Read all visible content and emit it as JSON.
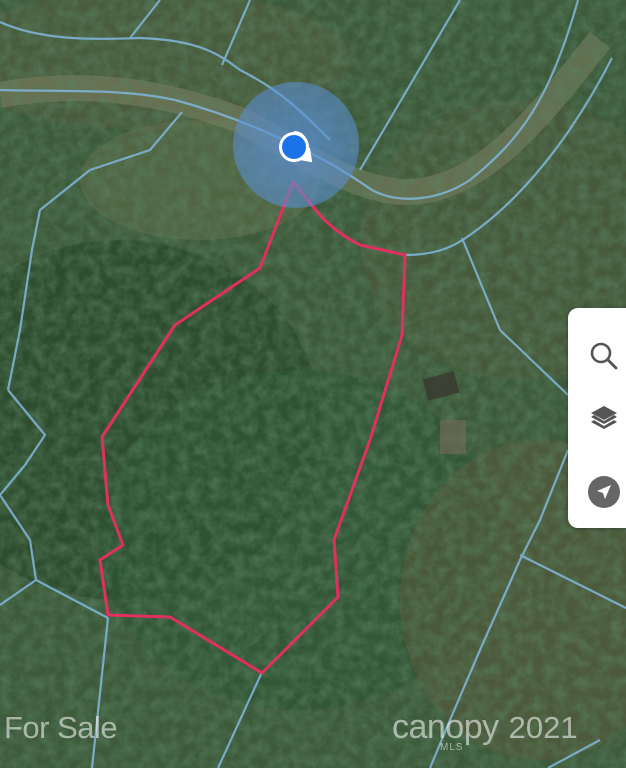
{
  "map": {
    "view": "satellite",
    "parcel_line_color": "#7fb3d5",
    "selected_parcel_color": "#e0305f",
    "location_dot_color": "#1a73e8",
    "location_halo_color": "#5b8fd6"
  },
  "toolbar": {
    "search_icon": "search-icon",
    "layers_icon": "layers-icon",
    "locate_icon": "navigation-arrow-icon"
  },
  "watermark": {
    "status": "For Sale",
    "brand": "canopy",
    "year": "2021",
    "brand_sub": "MLS"
  }
}
